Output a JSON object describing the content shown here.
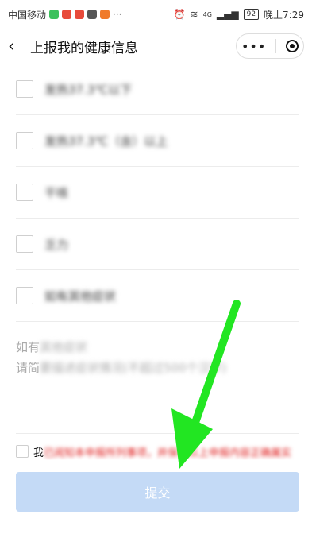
{
  "status_bar": {
    "carrier": "中国移动",
    "network": "4G",
    "battery": "92",
    "time": "晚上7:29"
  },
  "nav": {
    "title": "上报我的健康信息",
    "more_icon": "ellipsis-icon",
    "close_icon": "target-icon"
  },
  "options": [
    {
      "label": "发热37.3℃以下"
    },
    {
      "label": "发热37.3℃（含）以上"
    },
    {
      "label": "干咳"
    },
    {
      "label": "乏力"
    },
    {
      "label": "如有其他症状"
    }
  ],
  "remark": {
    "line1_visible": "如有",
    "line1_blurred": "其他症状",
    "line2_visible": "请简",
    "line2_blurred": "要描述症状情况(不超过500个汉字)"
  },
  "agreement": {
    "prefix": "我",
    "text": "已阅知本申报所列事项，并保证以上申报内容正确属实"
  },
  "submit_label": "提交",
  "colors": {
    "submit_bg": "#c4daf6",
    "arrow": "#22e622",
    "agree_text": "#e02020"
  }
}
